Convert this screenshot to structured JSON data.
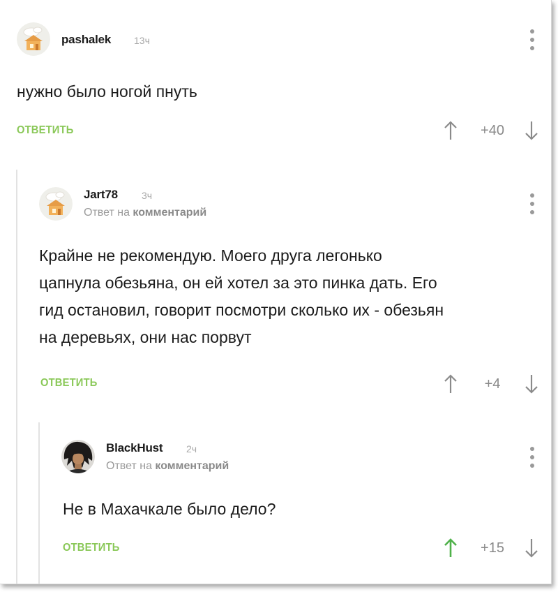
{
  "comments": [
    {
      "username": "pashalek",
      "time": "13ч",
      "reply_to": "",
      "text": "нужно было ногой пнуть",
      "reply_label": "ОТВЕТИТЬ",
      "rating": "+40",
      "upvoted": false
    },
    {
      "username": "Jart78",
      "time": "3ч",
      "reply_to_prefix": "Ответ на",
      "reply_to_link": "комментарий",
      "text_lines": [
        "Крайне не рекомендую. Моего друга легонько",
        "цапнула обезьяна, он ей хотел за это пинка дать. Его",
        "гид остановил, говорит посмотри сколько их - обезьян",
        "на деревьях, они нас порвут"
      ],
      "reply_label": "ОТВЕТИТЬ",
      "rating": "+4",
      "upvoted": false
    },
    {
      "username": "BlackHust",
      "time": "2ч",
      "reply_to_prefix": "Ответ на",
      "reply_to_link": "комментарий",
      "text": "Не в Махачкале было дело?",
      "reply_label": "ОТВЕТИТЬ",
      "rating": "+15",
      "upvoted": true
    }
  ],
  "colors": {
    "accent_green": "#8ac858",
    "arrow_gray": "#8a8a8a",
    "text": "#1c1c1c"
  },
  "icons": {
    "default_avatar": "house-avatar-icon",
    "user_avatar": "dark-hair-avatar",
    "upvote": "arrow-up-icon",
    "downvote": "arrow-down-icon",
    "menu": "more-vertical-icon"
  }
}
